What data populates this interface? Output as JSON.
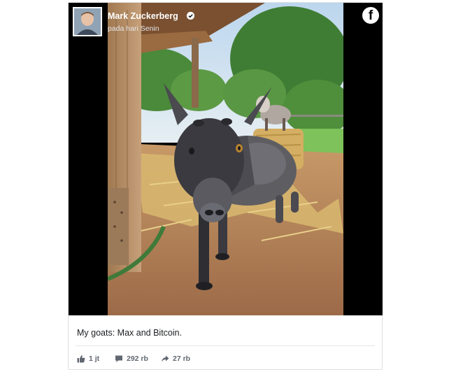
{
  "post": {
    "author_name": "Mark Zuckerberg",
    "timestamp": "pada hari Senin",
    "caption": "My goats: Max and Bitcoin.",
    "likes_count": "1 jt",
    "comments_count": "292 rb",
    "shares_count": "27 rb",
    "platform_logo": "f"
  },
  "icons": {
    "verified": "verified-badge-icon",
    "platform": "facebook-logo-icon",
    "like": "thumbs-up-icon",
    "comment": "comment-bubble-icon",
    "share": "share-arrow-icon"
  },
  "colors": {
    "media_background": "#000000",
    "stats_text": "#606770",
    "caption_text": "#1c1e21"
  }
}
